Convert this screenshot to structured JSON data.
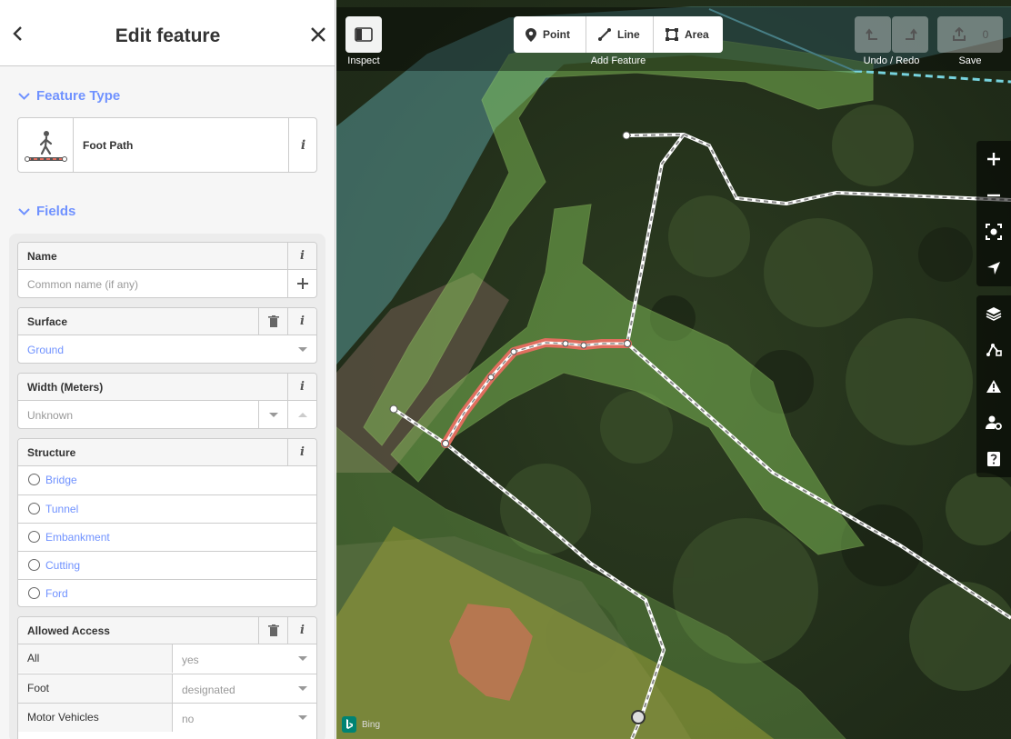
{
  "sidebar": {
    "title": "Edit feature",
    "feature_type": {
      "section_label": "Feature Type",
      "preset_name": "Foot Path"
    },
    "fields": {
      "section_label": "Fields",
      "name": {
        "label": "Name",
        "placeholder": "Common name (if any)"
      },
      "surface": {
        "label": "Surface",
        "value": "Ground"
      },
      "width": {
        "label": "Width (Meters)",
        "placeholder": "Unknown"
      },
      "structure": {
        "label": "Structure",
        "options": [
          "Bridge",
          "Tunnel",
          "Embankment",
          "Cutting",
          "Ford"
        ]
      },
      "access": {
        "label": "Allowed Access",
        "rows": [
          {
            "key": "All",
            "value": "yes"
          },
          {
            "key": "Foot",
            "value": "designated"
          },
          {
            "key": "Motor Vehicles",
            "value": "no"
          }
        ]
      }
    }
  },
  "toolbar": {
    "inspect_label": "Inspect",
    "add_feature_label": "Add Feature",
    "point_label": "Point",
    "line_label": "Line",
    "area_label": "Area",
    "undo_redo_label": "Undo / Redo",
    "save_label": "Save",
    "save_count": "0"
  },
  "map": {
    "attribution": "Bing",
    "colors": {
      "selected": "#e06e5f",
      "wood_fill": "#8cd05f",
      "wetland_fill": "#77d3de",
      "yellow_fill": "#d6c93a",
      "building": "#e06e5f",
      "path": "#ffffff"
    }
  }
}
